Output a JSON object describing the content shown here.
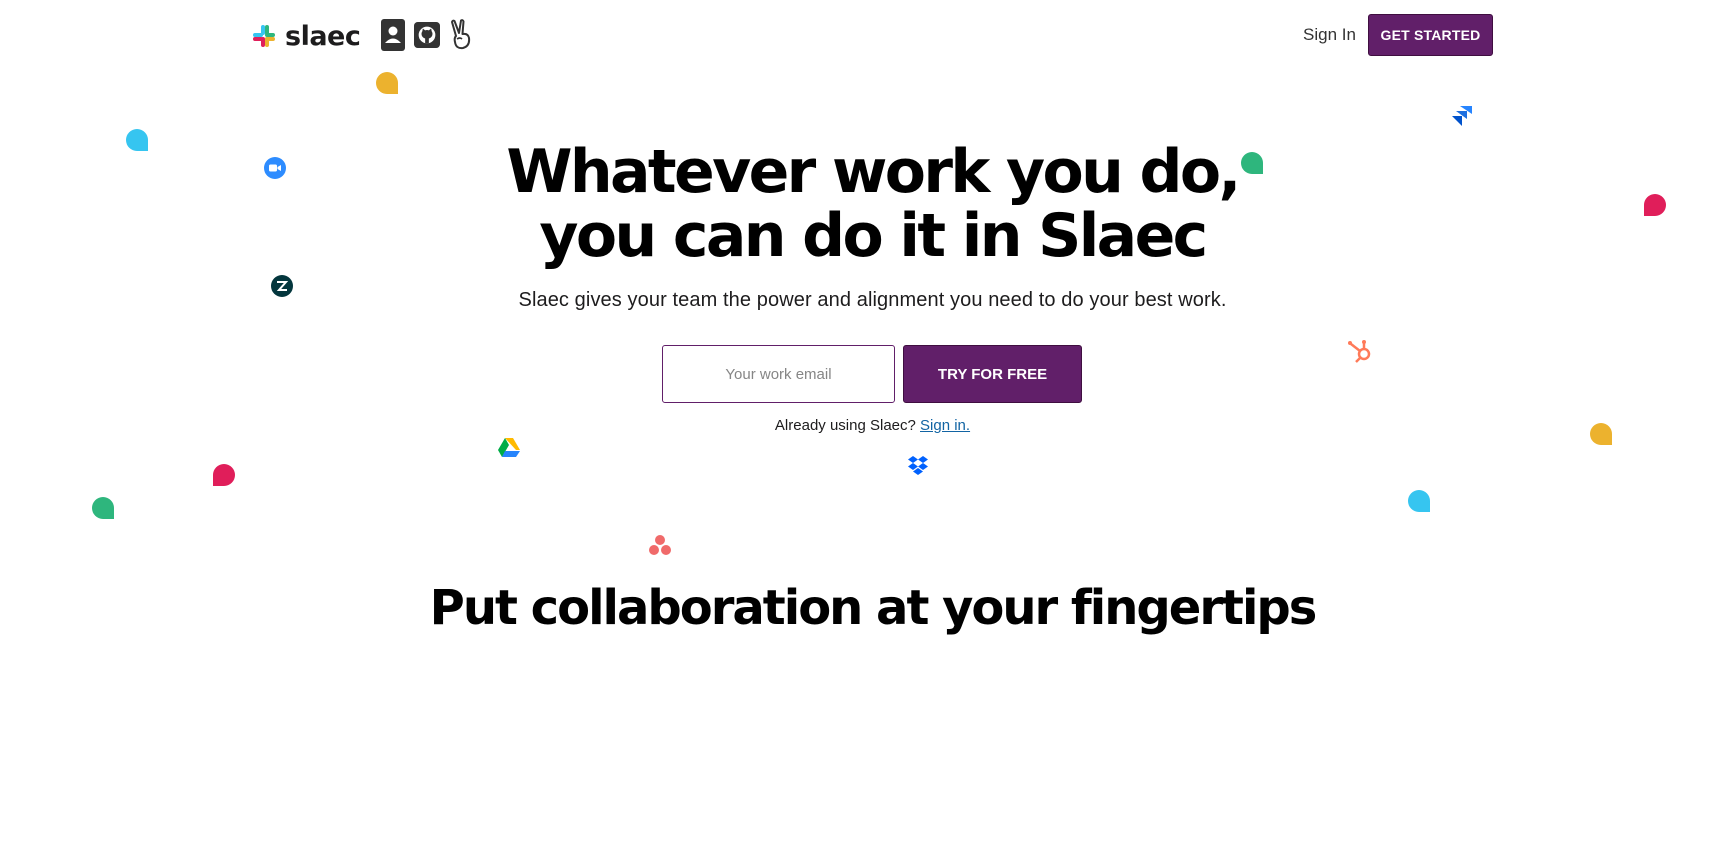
{
  "header": {
    "logo_text": "slaec",
    "utility_icons": [
      "contact-icon",
      "github-icon",
      "peace-hand-icon"
    ],
    "sign_in_label": "Sign In",
    "get_started_label": "GET STARTED"
  },
  "hero": {
    "title_line1": "Whatever work you do,",
    "title_line2": "you can do it in Slaec",
    "subtitle": "Slaec gives your team the power and alignment you need to do your best work.",
    "email_placeholder": "Your work email",
    "email_value": "",
    "try_label": "TRY FOR FREE",
    "already_text": "Already using Slaec?",
    "sign_in_link": "Sign in."
  },
  "section": {
    "title": "Put collaboration at your fingertips"
  },
  "decorations": [
    "zoom-icon",
    "zendesk-icon",
    "google-drive-icon",
    "dropbox-icon",
    "asana-icon",
    "hubspot-icon",
    "jira-icon",
    "chat-bubble-icon"
  ],
  "colors": {
    "brand": "#611f69",
    "link": "#1264a3",
    "bubble_yellow": "#ecb22e",
    "bubble_blue": "#36c5f0",
    "bubble_green": "#2eb67d",
    "bubble_red": "#e01e5a"
  }
}
